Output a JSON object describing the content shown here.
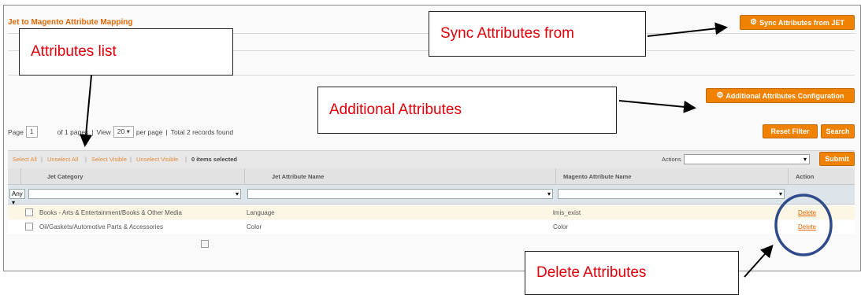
{
  "page": {
    "title": "Jet to Magento Attribute Mapping"
  },
  "buttons": {
    "sync": "Sync Attributes from JET",
    "additional": "Additional Attributes Configuration",
    "reset_filter": "Reset Filter",
    "search": "Search",
    "submit": "Submit"
  },
  "pager": {
    "page_label": "Page",
    "page_value": "1",
    "of_pages": "of 1 pages",
    "view_label": "View",
    "per_page_value": "20",
    "per_page_label": "per page",
    "total": "Total 2 records found"
  },
  "massaction": {
    "select_all": "Select All",
    "unselect_all": "Unselect All",
    "select_visible": "Select Visible",
    "unselect_visible": "Unselect Visible",
    "selected": "0 items selected",
    "actions_label": "Actions"
  },
  "grid": {
    "columns": [
      "Jet Category",
      "Jet Attribute Name",
      "Magento Attribute Name",
      "Action"
    ],
    "filter_any": "Any",
    "rows": [
      {
        "category": "Books - Arts & Entertainment/Books & Other Media",
        "jet_attr": "Language",
        "magento_attr": "lmis_exist",
        "action": "Delete"
      },
      {
        "category": "Oil/Gaskets/Automotive Parts & Accessories",
        "jet_attr": "Color",
        "magento_attr": "Color",
        "action": "Delete"
      }
    ]
  },
  "callouts": {
    "attributes_list": "Attributes list",
    "sync": "Sync Attributes from",
    "additional": "Additional Attributes",
    "delete": "Delete Attributes"
  },
  "colors": {
    "accent": "#f18200",
    "callout_text": "#e0000a",
    "circle": "#2e4a8a"
  }
}
